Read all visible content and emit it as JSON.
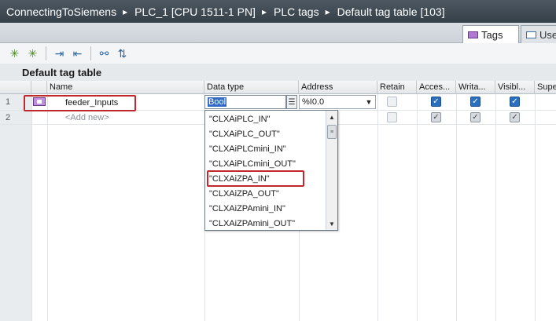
{
  "breadcrumb": [
    "ConnectingToSiemens",
    "PLC_1 [CPU 1511-1 PN]",
    "PLC tags",
    "Default tag table [103]"
  ],
  "tabs": [
    {
      "label": "Tags",
      "icon": "tag-table-icon",
      "active": true
    },
    {
      "label": "Use",
      "icon": "user-constants-icon",
      "active": false
    }
  ],
  "toolbar": [
    "add-row-icon",
    "insert-row-icon",
    "export-icon",
    "import-icon",
    "monitor-all-icon",
    "keep-actual-values-icon"
  ],
  "table_title": "Default tag table",
  "columns": [
    "Name",
    "Data type",
    "Address",
    "Retain",
    "Acces...",
    "Writa...",
    "Visibl...",
    "Supe"
  ],
  "rows": [
    {
      "num": "1",
      "name": "feeder_Inputs",
      "data_type": "Bool",
      "address": "%I0.0",
      "retain": false,
      "accessible": true,
      "writable": true,
      "visible": true
    },
    {
      "num": "2",
      "name": "<Add new>",
      "retain": false,
      "accessible": true,
      "writable": true,
      "visible": true
    }
  ],
  "datatype_options": [
    "\"CLXAiPLC_IN\"",
    "\"CLXAiPLC_OUT\"",
    "\"CLXAiPLCmini_IN\"",
    "\"CLXAiPLCmini_OUT\"",
    "\"CLXAiZPA_IN\"",
    "\"CLXAiZPA_OUT\"",
    "\"CLXAiZPAmini_IN\"",
    "\"CLXAiZPAmini_OUT\""
  ],
  "highlight_color": "#c0282d",
  "selection_color": "#316ac5"
}
